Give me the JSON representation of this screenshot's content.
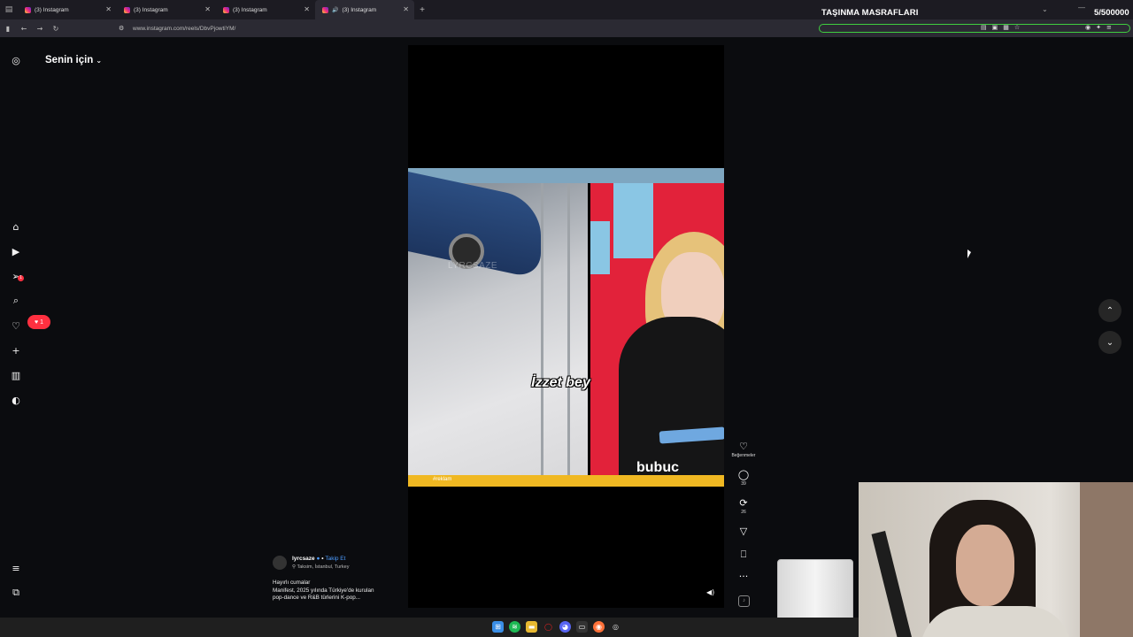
{
  "browser": {
    "tab_menu_icon": "list-icon",
    "tabs": [
      {
        "label": "(3) Instagram",
        "active": false
      },
      {
        "label": "(3) Instagram",
        "active": false
      },
      {
        "label": "(3) Instagram",
        "active": false
      },
      {
        "label": "(3) Instagram",
        "active": true,
        "audio": true
      }
    ],
    "url": "www.instagram.com/reels/DbvPjowtiYM/"
  },
  "stream_overlay": {
    "goal_title": "TAŞINMA MASRAFLARI",
    "goal_counter": "5/500000",
    "goal_progress": 0.0
  },
  "sidebar": {
    "feed_title": "Senin için",
    "notification_count": "1",
    "message_count": "1"
  },
  "reel": {
    "watermark": "LYRCSAZE",
    "subtitle": "İzzet bey",
    "channel_logo": "bubuc",
    "ticker": "#reklam",
    "author": {
      "username": "lyrcsaze",
      "follow_label": "Takip Et",
      "location": "Taksim, İstanbul, Turkey"
    },
    "caption_lines": [
      "Hayırlı cumalar",
      "Manifest, 2025 yılında Türkiye'de kurulan",
      "pop-dance ve R&B türlerini K-pop..."
    ]
  },
  "actions": {
    "like_label": "Beğenmeler",
    "comments": "39",
    "reposts": "26"
  },
  "colors": {
    "accent_red": "#ff3040",
    "link_blue": "#4c9cff",
    "goal_green": "#3fce3f"
  }
}
